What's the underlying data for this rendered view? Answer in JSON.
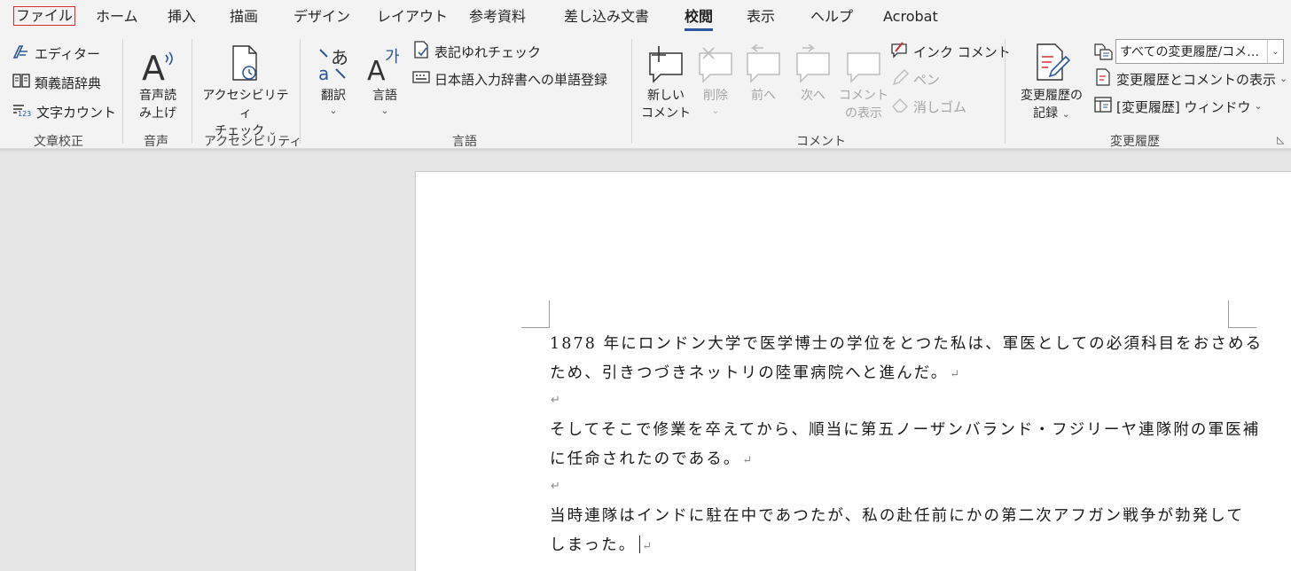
{
  "tabs": [
    "ファイル",
    "ホーム",
    "挿入",
    "描画",
    "デザイン",
    "レイアウト",
    "参考資料",
    "差し込み文書",
    "校閲",
    "表示",
    "ヘルプ",
    "Acrobat"
  ],
  "active_tab": "校閲",
  "groups": {
    "proofing": {
      "label": "文章校正",
      "editor": "エディター",
      "thesaurus": "類義語辞典",
      "word_count": "文字カウント"
    },
    "speech": {
      "label": "音声",
      "read_aloud_1": "音声読",
      "read_aloud_2": "み上げ"
    },
    "accessibility": {
      "label": "アクセシビリティ",
      "check_1": "アクセシビリティ",
      "check_2": "チェック"
    },
    "language": {
      "label": "言語",
      "translate": "翻訳",
      "language": "言語",
      "spelling_variants": "表記ゆれチェック",
      "ime_dictionary": "日本語入力辞書への単語登録"
    },
    "comments": {
      "label": "コメント",
      "new_1": "新しい",
      "new_2": "コメント",
      "delete": "削除",
      "previous": "前へ",
      "next": "次へ",
      "show_1": "コメント",
      "show_2": "の表示",
      "ink_comment": "インク コメント",
      "pen": "ペン",
      "eraser": "消しゴム"
    },
    "tracking": {
      "label": "変更履歴",
      "track_1": "変更履歴の",
      "track_2": "記録",
      "markup_select": "すべての変更履歴/コメ…",
      "show_markup": "変更履歴とコメントの表示",
      "reviewing_pane": "[変更履歴] ウィンドウ"
    }
  },
  "document": {
    "lines": [
      "1878 年にロンドン大学で医学博士の学位をとつた私は、軍医としての必須科目をおさめる",
      "ため、引きつづきネットリの陸軍病院へと進んだ。",
      "そしてそこで修業を卒えてから、順当に第五ノーザンバランド・フジリーヤ連隊附の軍医補",
      "に任命されたのである。",
      "当時連隊はインドに駐在中であつたが、私の赴任前にかの第二次アフガン戦争が勃発して",
      "しまった。"
    ],
    "paragraph_mark": "↵"
  },
  "colors": {
    "ribbon_bg": "#f3f3f3",
    "workspace_bg": "#e6e6e6",
    "accent": "#2b579a",
    "file_highlight": "#d42b2b"
  }
}
